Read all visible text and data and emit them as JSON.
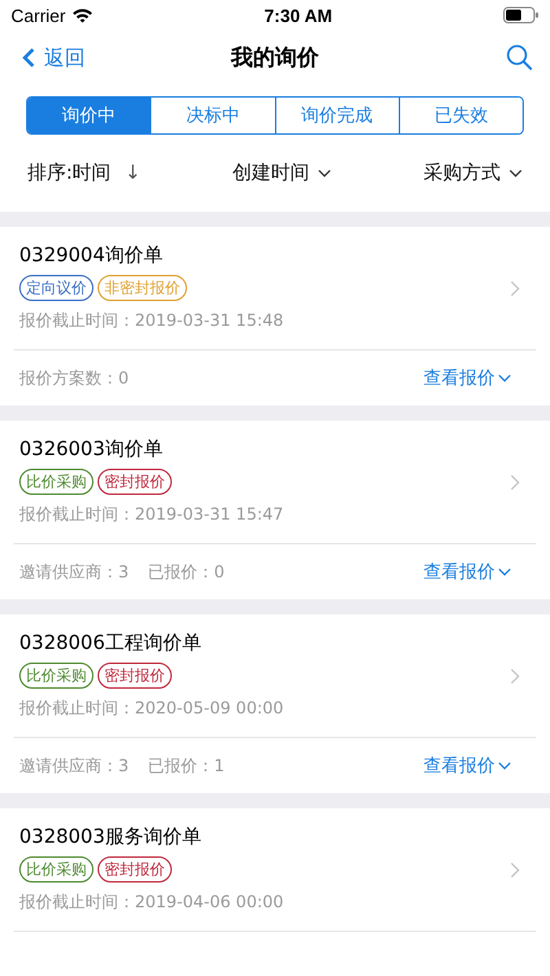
{
  "status_bar": {
    "carrier": "Carrier",
    "time": "7:30 AM"
  },
  "nav": {
    "back": "返回",
    "title": "我的询价"
  },
  "tabs": [
    {
      "label": "询价中",
      "selected": true
    },
    {
      "label": "决标中",
      "selected": false
    },
    {
      "label": "询价完成",
      "selected": false
    },
    {
      "label": "已失效",
      "selected": false
    }
  ],
  "sort_bar": {
    "sort": "排序:时间",
    "arrow": "↓",
    "filters": [
      "创建时间",
      "采购方式"
    ]
  },
  "cards": [
    {
      "title": "0329004询价单",
      "tags": [
        {
          "label": "定向议价",
          "color": "#3a6fc4"
        },
        {
          "label": "非密封报价",
          "color": "#e0a030"
        }
      ],
      "deadline": "报价截止时间：2019-03-31 15:48",
      "stats": [
        "报价方案数：0"
      ],
      "action": "查看报价"
    },
    {
      "title": "0326003询价单",
      "tags": [
        {
          "label": "比价采购",
          "color": "#4d8a2e"
        },
        {
          "label": "密封报价",
          "color": "#c0283c"
        }
      ],
      "deadline": "报价截止时间：2019-03-31 15:47",
      "stats": [
        "邀请供应商：3",
        "已报价：0"
      ],
      "action": "查看报价"
    },
    {
      "title": "0328006工程询价单",
      "tags": [
        {
          "label": "比价采购",
          "color": "#4d8a2e"
        },
        {
          "label": "密封报价",
          "color": "#c0283c"
        }
      ],
      "deadline": "报价截止时间：2020-05-09 00:00",
      "stats": [
        "邀请供应商：3",
        "已报价：1"
      ],
      "action": "查看报价"
    },
    {
      "title": "0328003服务询价单",
      "tags": [
        {
          "label": "比价采购",
          "color": "#4d8a2e"
        },
        {
          "label": "密封报价",
          "color": "#c0283c"
        }
      ],
      "deadline": "报价截止时间：2019-04-06 00:00"
    }
  ]
}
